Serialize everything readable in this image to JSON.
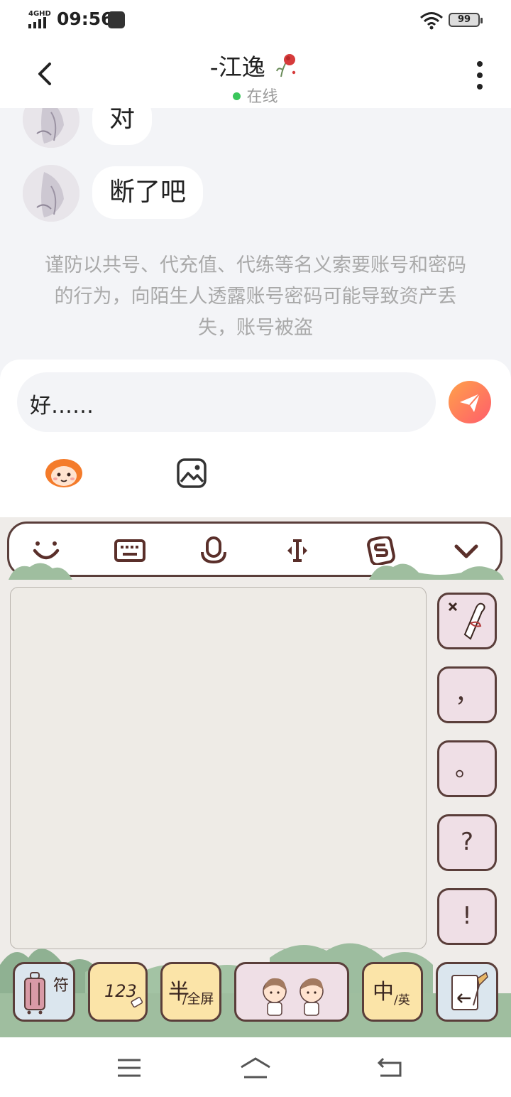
{
  "status_bar": {
    "network": "4GHD",
    "time": "09:56",
    "battery": "99"
  },
  "header": {
    "title": "-江逸",
    "status": "在线"
  },
  "messages": [
    {
      "text": "对"
    },
    {
      "text": "断了吧"
    }
  ],
  "notice": "谨防以共号、代充值、代练等名义索要账号和密码的行为，向陌生人透露账号密码可能导致资产丢失，账号被盗",
  "input": {
    "value": "好……"
  },
  "keyboard": {
    "side_keys": [
      "，",
      "。",
      "?",
      "!"
    ],
    "bottom_keys": {
      "symbol": "符",
      "numeric": "123",
      "half_full_main": "半",
      "half_full_sub": "/全屏",
      "lang_main": "中",
      "lang_sub": "/英"
    }
  },
  "colors": {
    "online": "#3ac65b",
    "send_start": "#ffa14a",
    "send_end": "#ff5d6c",
    "key_outline": "#5a3e3a"
  }
}
